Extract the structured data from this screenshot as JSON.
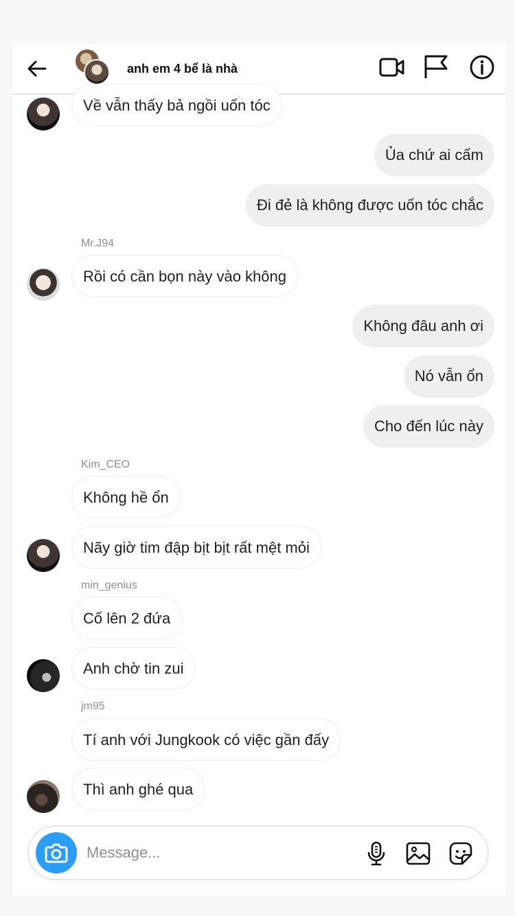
{
  "header": {
    "title": "anh em 4 bể là nhà",
    "icons": [
      "back-arrow-icon",
      "video-call-icon",
      "flag-icon",
      "info-icon"
    ]
  },
  "messages": [
    {
      "dir": "in",
      "text": "Về vẫn thấy bả ngồi uốn tóc",
      "avatar": "av-1"
    },
    {
      "dir": "out",
      "text": "Ủa chứ ai cấm"
    },
    {
      "dir": "out",
      "text": "Đi đẻ là không được uốn tóc chắc"
    },
    {
      "sender": "Mr.J94"
    },
    {
      "dir": "in",
      "text": "Rồi có cần bọn này vào không",
      "avatar": "av-2"
    },
    {
      "dir": "out",
      "text": "Không đâu anh ơi"
    },
    {
      "dir": "out",
      "text": "Nó vẫn ổn"
    },
    {
      "dir": "out",
      "text": "Cho đến lúc này"
    },
    {
      "sender": "Kim_CEO"
    },
    {
      "dir": "in",
      "text": "Không hề ổn"
    },
    {
      "dir": "in",
      "text": "Nãy giờ tim đập bịt bịt rất mệt mỏi",
      "avatar": "av-1"
    },
    {
      "sender": "min_genius"
    },
    {
      "dir": "in",
      "text": "Cố lên 2 đứa"
    },
    {
      "dir": "in",
      "text": "Anh chờ tin zui",
      "avatar": "av-3"
    },
    {
      "sender": "jm95"
    },
    {
      "dir": "in",
      "text": "Tí anh với Jungkook có việc gần đấy"
    },
    {
      "dir": "in",
      "text": "Thì anh ghé qua",
      "avatar": "av-4"
    }
  ],
  "composer": {
    "placeholder": "Message...",
    "icons": [
      "camera-icon",
      "microphone-icon",
      "gallery-icon",
      "sticker-icon"
    ]
  },
  "colors": {
    "accent": "#2a9df4",
    "outgoing_bubble": "#efefef",
    "incoming_border": "#ececec",
    "sender_label": "#8e8e8e"
  }
}
